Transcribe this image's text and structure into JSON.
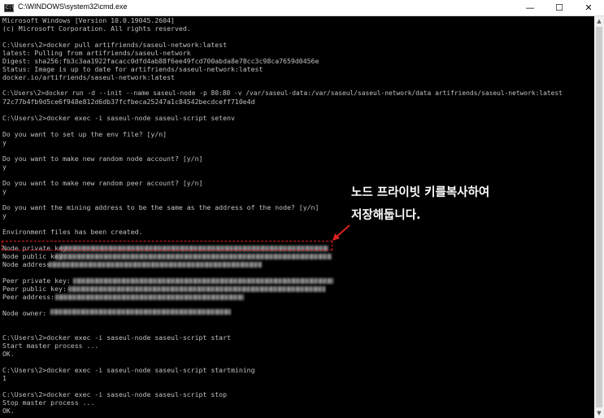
{
  "window": {
    "title": "C:\\WINDOWS\\system32\\cmd.exe",
    "icon_glyph": "C:\\",
    "minimize": "—",
    "maximize": "☐",
    "close": "✕"
  },
  "console": {
    "lines": [
      "Microsoft Windows [Version 10.0.19045.2604]",
      "(c) Microsoft Corporation. All rights reserved.",
      "",
      "C:\\Users\\2>docker pull artifriends/saseul-network:latest",
      "latest: Pulling from artifriends/saseul-network",
      "Digest: sha256:fb3c3aa1922facacc0dfd4ab88f6ee49fcd700abda8e78cc3c98ca7659d0456e",
      "Status: Image is up to date for artifriends/saseul-network:latest",
      "docker.io/artifriends/saseul-network:latest",
      "",
      "C:\\Users\\2>docker run -d --init --name saseul-node -p 80:80 -v /var/saseul-data:/var/saseul/saseul-network/data artifriends/saseul-network:latest",
      "72c77b4fb9d5ce6f948e812d6db37fcfbeca25247a1c84542becdceff710e4d",
      "",
      "C:\\Users\\2>docker exec -i saseul-node saseul-script setenv",
      "",
      "Do you want to set up the env file? [y/n]",
      "y",
      "",
      "Do you want to make new random node account? [y/n]",
      "y",
      "",
      "Do you want to make new random peer account? [y/n]",
      "y",
      "",
      "Do you want the mining address to be the same as the address of the node? [y/n]",
      "y",
      "",
      "Environment files has been created.",
      "",
      "Node private key:",
      "Node public key:",
      "Node address:",
      "",
      "Peer private key:",
      "Peer public key:",
      "Peer address:",
      "",
      "Node owner:",
      "",
      "",
      "C:\\Users\\2>docker exec -i saseul-node saseul-script start",
      "Start master process ...",
      "OK.",
      "",
      "C:\\Users\\2>docker exec -i saseul-node saseul-script startmining",
      "1",
      "",
      "C:\\Users\\2>docker exec -i saseul-node saseul-script stop",
      "Stop master process ...",
      "OK."
    ]
  },
  "annotation": {
    "line1": "노드 프라이빗 키를복사하여",
    "line2": "저장해둡니다."
  },
  "colors": {
    "console_bg": "#000000",
    "console_text": "#c0c0c0",
    "highlight": "#e02020",
    "annotation_text": "#ffffff"
  }
}
